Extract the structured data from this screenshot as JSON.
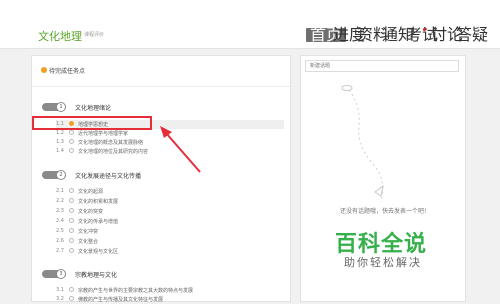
{
  "header": {
    "title": "文化地理",
    "subtitle": "课程评价",
    "nav": [
      {
        "label": "首页",
        "active": true
      },
      {
        "label": "进度",
        "active": false
      },
      {
        "label": "资料",
        "active": false
      },
      {
        "label": "通知",
        "active": false
      },
      {
        "label": "考试",
        "active": false,
        "badge": true
      },
      {
        "label": "讨论",
        "active": false
      },
      {
        "label": "答疑",
        "active": false
      }
    ]
  },
  "left": {
    "pending_label": "待完成任务点",
    "chapters": [
      {
        "num": "1",
        "title": "文化地理绪论",
        "lessons": [
          {
            "num": "1.1",
            "title": "地理学思想史",
            "active": true
          },
          {
            "num": "1.2",
            "title": "近代地理学与地理学家"
          },
          {
            "num": "1.3",
            "title": "文化地理的概念及其发展脉络"
          },
          {
            "num": "1.4",
            "title": "文化地理的地位及其研究的内容"
          }
        ]
      },
      {
        "num": "2",
        "title": "文化发展途径与文化传播",
        "lessons": [
          {
            "num": "2.1",
            "title": "文化的起源"
          },
          {
            "num": "2.2",
            "title": "文化的积累和发展"
          },
          {
            "num": "2.3",
            "title": "文化的突变"
          },
          {
            "num": "2.4",
            "title": "文化的传承与增值"
          },
          {
            "num": "2.5",
            "title": "文化冲突"
          },
          {
            "num": "2.6",
            "title": "文化整合"
          },
          {
            "num": "2.7",
            "title": "文化景观与文化区"
          }
        ]
      },
      {
        "num": "3",
        "title": "宗教地理与文化",
        "lessons": [
          {
            "num": "3.1",
            "title": "宗教的产生与世界的主要宗教之其大数的特点与发展"
          },
          {
            "num": "3.2",
            "title": "佛教的产生与传播及其文化特征与发展"
          }
        ]
      }
    ]
  },
  "right": {
    "search_placeholder": "新建话题",
    "empty_text": "还没有话题哦，快去发表一个吧!"
  },
  "watermark": {
    "main": "百科全说",
    "sub": "助你轻松解决"
  },
  "colors": {
    "accent": "#5aa42a",
    "annotation": "#e62e3a",
    "watermark": "#35b04a"
  }
}
